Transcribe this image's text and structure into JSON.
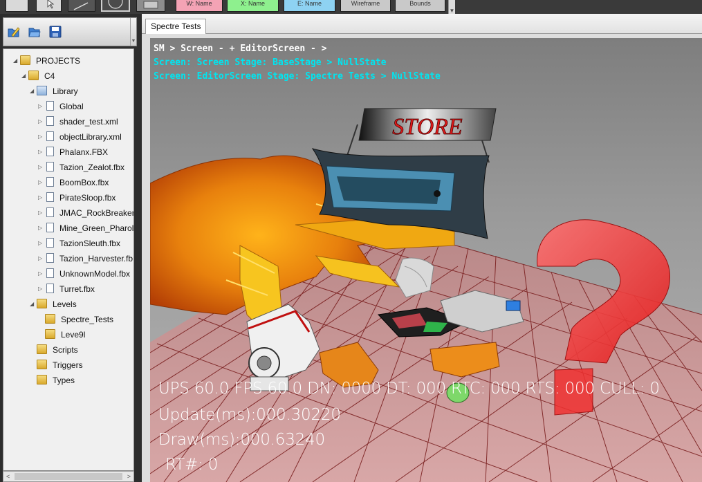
{
  "toolbar": {
    "colored_buttons": [
      "W: Name",
      "X: Name",
      "E: Name",
      "Wireframe",
      "Bounds"
    ]
  },
  "tree": [
    {
      "label": "PROJECTS",
      "icon": "folder-icon",
      "depth": 0,
      "expanded": true
    },
    {
      "label": "C4",
      "icon": "folder-icon",
      "depth": 1,
      "expanded": true
    },
    {
      "label": "Library",
      "icon": "library-icon",
      "depth": 2,
      "expanded": true
    },
    {
      "label": "Global",
      "icon": "file-icon",
      "depth": 3,
      "expanded": false
    },
    {
      "label": "shader_test.xml",
      "icon": "file-icon",
      "depth": 3,
      "expanded": false
    },
    {
      "label": "objectLibrary.xml",
      "icon": "file-icon",
      "depth": 3,
      "expanded": false
    },
    {
      "label": "Phalanx.FBX",
      "icon": "file-icon",
      "depth": 3,
      "expanded": false
    },
    {
      "label": "Tazion_Zealot.fbx",
      "icon": "file-icon",
      "depth": 3,
      "expanded": false
    },
    {
      "label": "BoomBox.fbx",
      "icon": "file-icon",
      "depth": 3,
      "expanded": false
    },
    {
      "label": "PirateSloop.fbx",
      "icon": "file-icon",
      "depth": 3,
      "expanded": false
    },
    {
      "label": "JMAC_RockBreaker",
      "icon": "file-icon",
      "depth": 3,
      "expanded": false
    },
    {
      "label": "Mine_Green_Pharol",
      "icon": "file-icon",
      "depth": 3,
      "expanded": false
    },
    {
      "label": "TazionSleuth.fbx",
      "icon": "file-icon",
      "depth": 3,
      "expanded": false
    },
    {
      "label": "Tazion_Harvester.fb",
      "icon": "file-icon",
      "depth": 3,
      "expanded": false
    },
    {
      "label": "UnknownModel.fbx",
      "icon": "file-icon",
      "depth": 3,
      "expanded": false
    },
    {
      "label": "Turret.fbx",
      "icon": "file-icon",
      "depth": 3,
      "expanded": false
    },
    {
      "label": "Levels",
      "icon": "folder-icon",
      "depth": 2,
      "expanded": true
    },
    {
      "label": "Spectre_Tests",
      "icon": "folder-icon",
      "depth": 3,
      "expanded": null
    },
    {
      "label": "Leve9l",
      "icon": "folder-icon",
      "depth": 3,
      "expanded": null
    },
    {
      "label": "Scripts",
      "icon": "folder-icon",
      "depth": 2,
      "expanded": null
    },
    {
      "label": "Triggers",
      "icon": "folder-icon",
      "depth": 2,
      "expanded": null
    },
    {
      "label": "Types",
      "icon": "folder-icon",
      "depth": 2,
      "expanded": null
    }
  ],
  "document": {
    "tab_label": "Spectre Tests"
  },
  "viewport": {
    "hud": {
      "state_line": "SM > Screen -  + EditorScreen -  >",
      "screen_line_1": "Screen: Screen Stage: BaseStage > NullState",
      "screen_line_2": "Screen: EditorScreen Stage: Spectre Tests > NullState"
    },
    "sign_text": "STORE",
    "stats": {
      "perf": "UPS 60.0 FPS 60.0 DN: 0000 DT: 000 RTC: 000 RTS: 000 CULL: 0",
      "update": "Update(ms):000.30220",
      "draw": "Draw(ms):000.63240",
      "rt": "RT#: 0"
    }
  }
}
